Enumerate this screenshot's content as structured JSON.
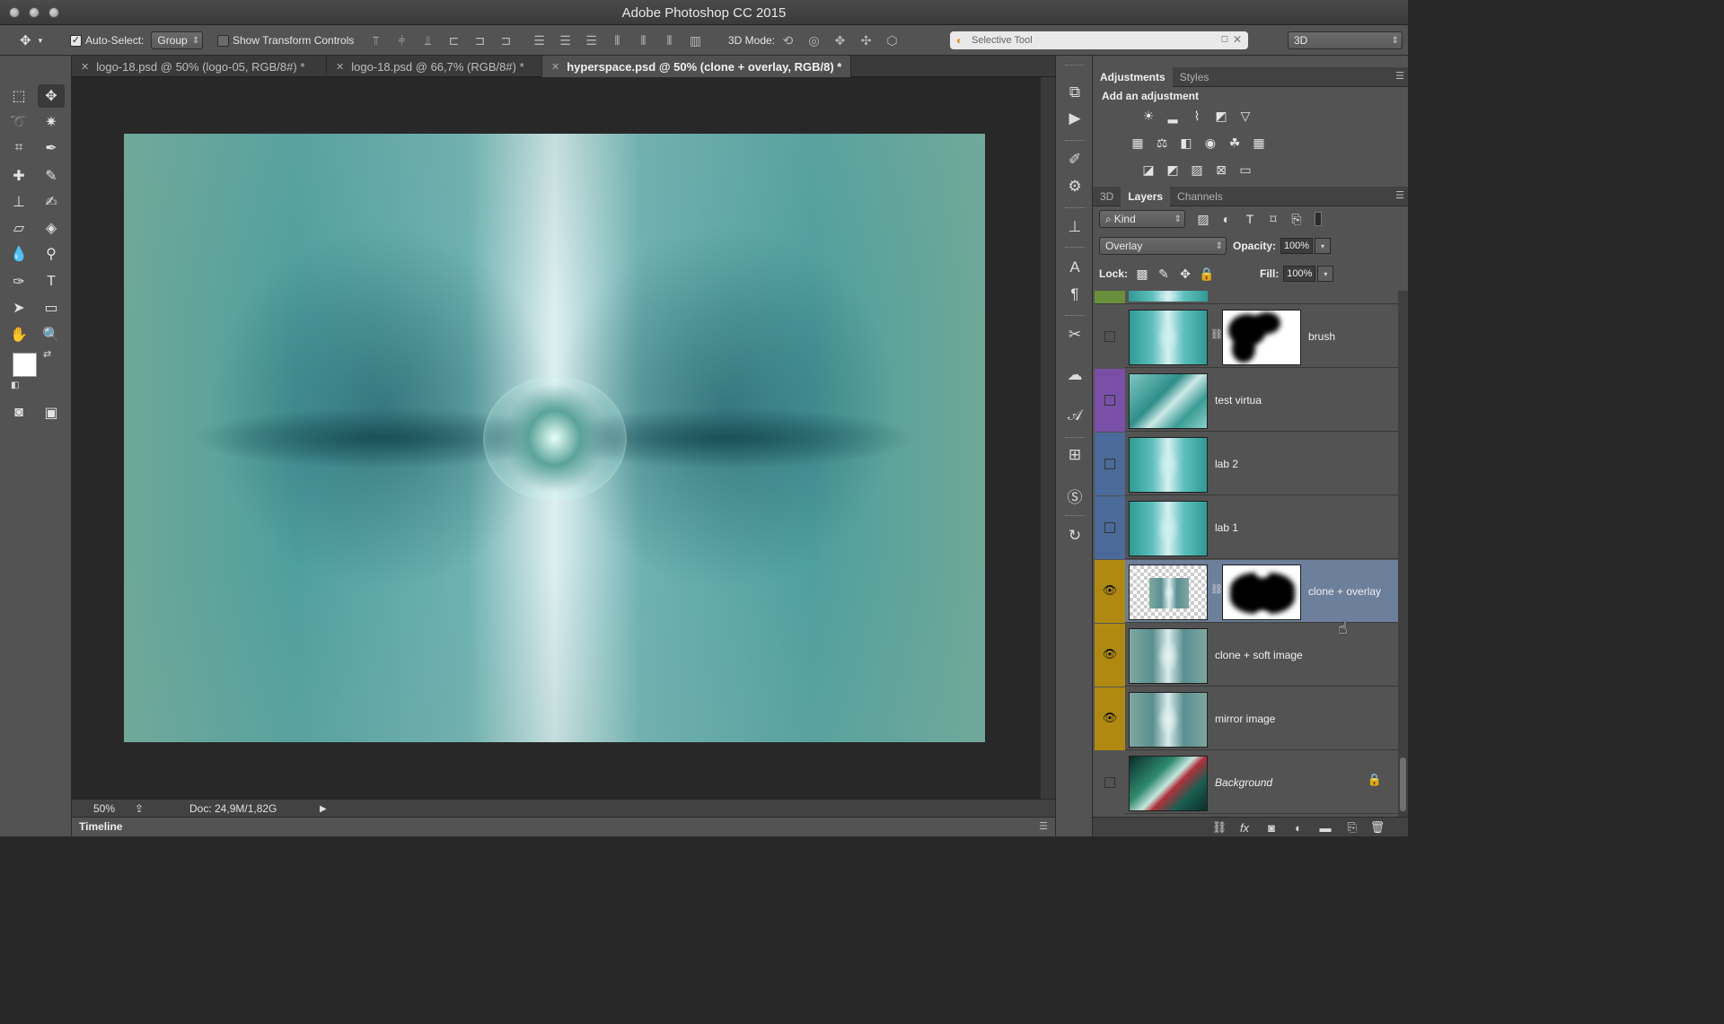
{
  "window": {
    "title": "Adobe Photoshop CC 2015"
  },
  "options_bar": {
    "auto_select_label": "Auto-Select:",
    "auto_select_value": "Group",
    "show_transform_label": "Show Transform Controls",
    "mode_3d_label": "3D Mode:",
    "search_placeholder": "Selective Tool",
    "workspace_value": "3D"
  },
  "tabs": [
    {
      "label": "logo-18.psd @ 50% (logo-05, RGB/8#) *"
    },
    {
      "label": "logo-18.psd @ 66,7% (RGB/8#) *"
    },
    {
      "label": "hyperspace.psd @ 50% (clone + overlay, RGB/8) *"
    }
  ],
  "status_bar": {
    "zoom": "50%",
    "doc_info": "Doc: 24,9M/1,82G"
  },
  "timeline_label": "Timeline",
  "adjustments_panel": {
    "tabs": [
      "Adjustments",
      "Styles"
    ],
    "heading": "Add an adjustment"
  },
  "layers_panel": {
    "tabs": [
      "3D",
      "Layers",
      "Channels"
    ],
    "filter_value": "Kind",
    "blend_mode": "Overlay",
    "opacity_label": "Opacity:",
    "opacity_value": "100%",
    "lock_label": "Lock:",
    "fill_label": "Fill:",
    "fill_value": "100%",
    "layers": [
      {
        "name": "brush",
        "visible": false,
        "color": "#535353"
      },
      {
        "name": "test virtua",
        "visible": false,
        "color": "#7a4fa8"
      },
      {
        "name": "lab 2",
        "visible": false,
        "color": "#4a6a9a"
      },
      {
        "name": "lab 1",
        "visible": false,
        "color": "#4a6a9a"
      },
      {
        "name": "clone + overlay",
        "visible": true,
        "color": "#b08a10",
        "selected": true
      },
      {
        "name": "clone + soft image",
        "visible": true,
        "color": "#b08a10"
      },
      {
        "name": "mirror image",
        "visible": true,
        "color": "#b08a10"
      },
      {
        "name": "Background",
        "visible": false,
        "color": "#535353",
        "locked": true
      }
    ]
  },
  "colors": {
    "layer_group_purple": "#7a4fa8",
    "layer_group_blue": "#4a6a9a",
    "layer_group_yellow": "#b08a10",
    "selected_row": "#6c7f9b"
  }
}
